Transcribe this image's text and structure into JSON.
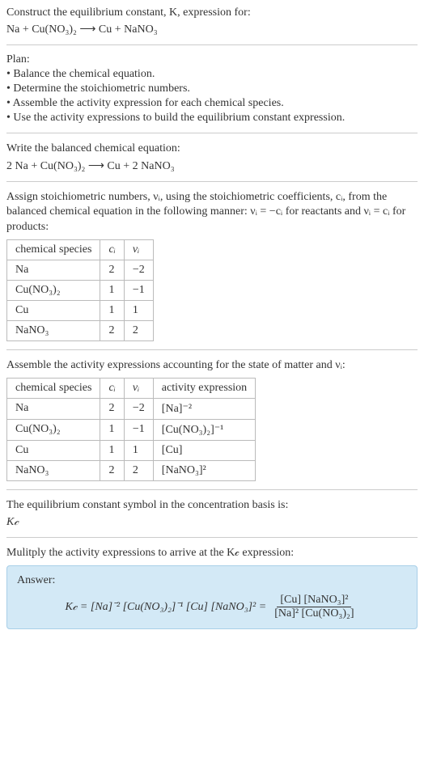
{
  "prompt": {
    "line1": "Construct the equilibrium constant, K, expression for:",
    "equation": "Na + Cu(NO₃)₂  ⟶  Cu + NaNO₃"
  },
  "plan": {
    "head": "Plan:",
    "items": [
      "• Balance the chemical equation.",
      "• Determine the stoichiometric numbers.",
      "• Assemble the activity expression for each chemical species.",
      "• Use the activity expressions to build the equilibrium constant expression."
    ]
  },
  "balanced": {
    "head": "Write the balanced chemical equation:",
    "equation": "2 Na + Cu(NO₃)₂  ⟶  Cu + 2 NaNO₃"
  },
  "assign": {
    "text": "Assign stoichiometric numbers, νᵢ, using the stoichiometric coefficients, cᵢ, from the balanced chemical equation in the following manner: νᵢ = −cᵢ for reactants and νᵢ = cᵢ for products:",
    "headers": {
      "species": "chemical species",
      "ci": "cᵢ",
      "vi": "νᵢ"
    },
    "rows": [
      {
        "species": "Na",
        "ci": "2",
        "vi": "−2"
      },
      {
        "species": "Cu(NO₃)₂",
        "ci": "1",
        "vi": "−1"
      },
      {
        "species": "Cu",
        "ci": "1",
        "vi": "1"
      },
      {
        "species": "NaNO₃",
        "ci": "2",
        "vi": "2"
      }
    ]
  },
  "activity": {
    "text": "Assemble the activity expressions accounting for the state of matter and νᵢ:",
    "headers": {
      "species": "chemical species",
      "ci": "cᵢ",
      "vi": "νᵢ",
      "expr": "activity expression"
    },
    "rows": [
      {
        "species": "Na",
        "ci": "2",
        "vi": "−2",
        "expr": "[Na]⁻²"
      },
      {
        "species": "Cu(NO₃)₂",
        "ci": "1",
        "vi": "−1",
        "expr": "[Cu(NO₃)₂]⁻¹"
      },
      {
        "species": "Cu",
        "ci": "1",
        "vi": "1",
        "expr": "[Cu]"
      },
      {
        "species": "NaNO₃",
        "ci": "2",
        "vi": "2",
        "expr": "[NaNO₃]²"
      }
    ]
  },
  "symbol": {
    "text": "The equilibrium constant symbol in the concentration basis is:",
    "kc": "K𝒸"
  },
  "multiply": {
    "text": "Mulitply the activity expressions to arrive at the K𝒸 expression:"
  },
  "answer": {
    "label": "Answer:",
    "lhs": "K𝒸 = [Na]⁻² [Cu(NO₃)₂]⁻¹ [Cu] [NaNO₃]² = ",
    "num": "[Cu] [NaNO₃]²",
    "den": "[Na]² [Cu(NO₃)₂]"
  }
}
